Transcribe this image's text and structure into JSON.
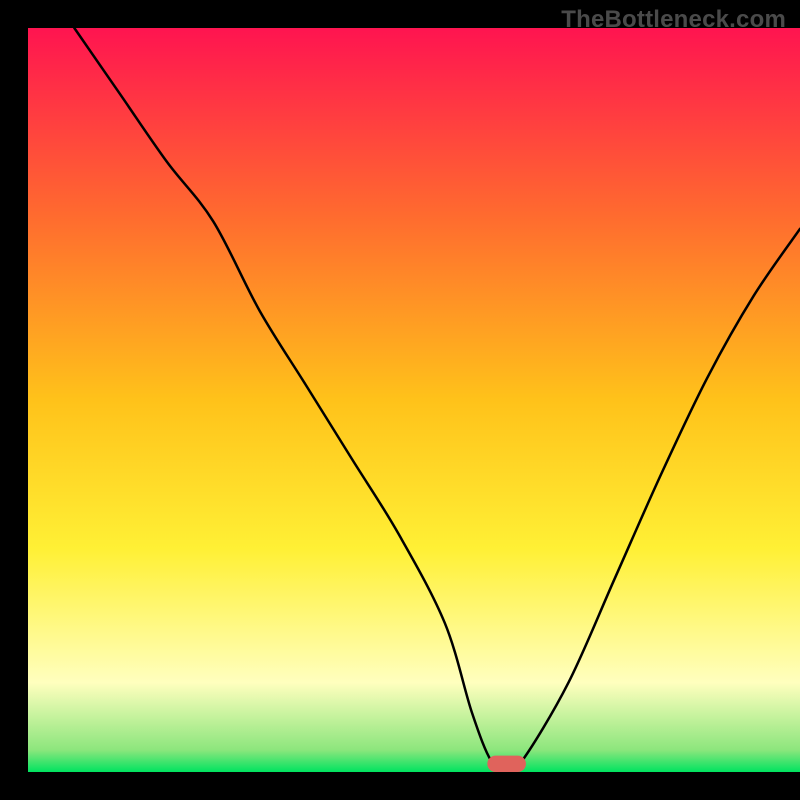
{
  "watermark": "TheBottleneck.com",
  "chart_data": {
    "type": "line",
    "title": "",
    "xlabel": "",
    "ylabel": "",
    "xlim": [
      0,
      100
    ],
    "ylim": [
      0,
      100
    ],
    "grid": false,
    "legend": false,
    "background_gradient": {
      "stops": [
        {
          "offset": 0.0,
          "color": "#ff1450"
        },
        {
          "offset": 0.25,
          "color": "#ff6a2f"
        },
        {
          "offset": 0.5,
          "color": "#ffc21a"
        },
        {
          "offset": 0.7,
          "color": "#fff035"
        },
        {
          "offset": 0.88,
          "color": "#ffffbe"
        },
        {
          "offset": 0.97,
          "color": "#8de67d"
        },
        {
          "offset": 1.0,
          "color": "#00e360"
        }
      ]
    },
    "series": [
      {
        "name": "bottleneck-curve",
        "x": [
          6,
          12,
          18,
          24,
          30,
          36,
          42,
          48,
          54,
          57.5,
          60,
          62,
          64,
          70,
          76,
          82,
          88,
          94,
          100
        ],
        "y": [
          100,
          91,
          82,
          74,
          62,
          52,
          42,
          32,
          20,
          8,
          1.5,
          0.5,
          1.5,
          12,
          26,
          40,
          53,
          64,
          73
        ]
      }
    ],
    "marker": {
      "name": "optimal-marker",
      "x_center": 62,
      "width": 5,
      "height": 2.2,
      "color": "#e0635c"
    },
    "frame": {
      "left_margin_pct": 3.5,
      "right_margin_pct": 0,
      "top_margin_pct": 3.5,
      "bottom_margin_pct": 3.5
    }
  }
}
